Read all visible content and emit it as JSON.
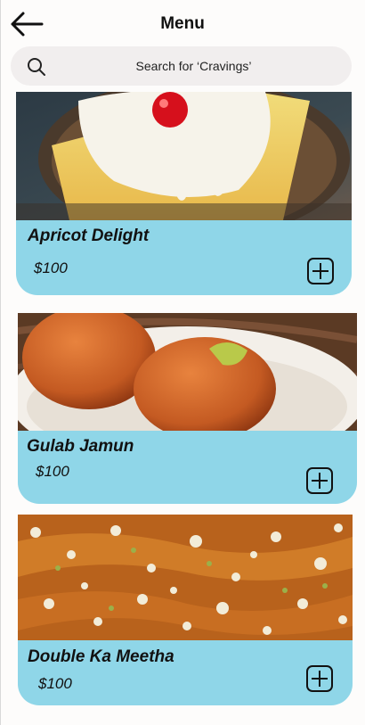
{
  "header": {
    "title": "Menu",
    "back_icon": "arrow-left-icon"
  },
  "search": {
    "placeholder": "Search for ‘Cravings’",
    "icon": "search-icon"
  },
  "colors": {
    "card_bg": "#8fd6e8",
    "search_bg": "#f1eeee"
  },
  "items": [
    {
      "name": "Apricot Delight",
      "price": "$100",
      "image": "apricot-delight-photo",
      "add_icon": "plus-square-icon"
    },
    {
      "name": "Gulab Jamun",
      "price": "$100",
      "image": "gulab-jamun-photo",
      "add_icon": "plus-square-icon"
    },
    {
      "name": "Double Ka Meetha",
      "price": "$100",
      "image": "double-ka-meetha-photo",
      "add_icon": "plus-square-icon"
    }
  ]
}
